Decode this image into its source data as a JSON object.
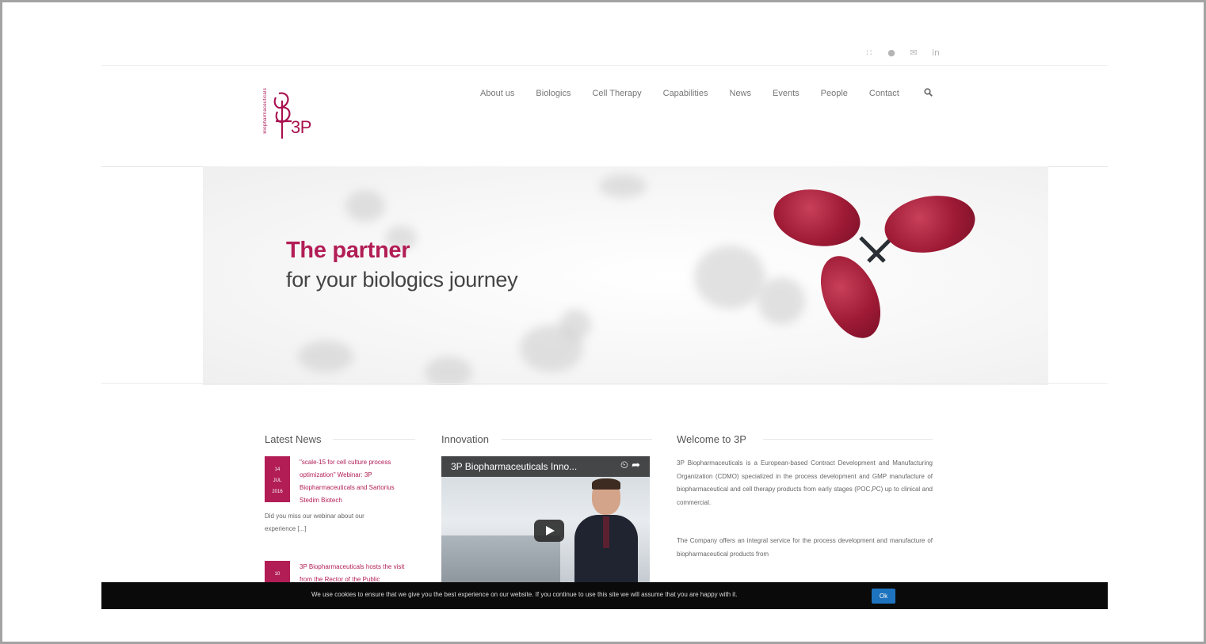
{
  "social": {
    "icons": [
      "rss-icon",
      "twitter-icon",
      "email-icon",
      "linkedin-icon"
    ],
    "glyphs": [
      ")",
      "•",
      "✉",
      "in"
    ]
  },
  "logo": {
    "text": "3P",
    "vertical": "Biopharmaceuticals",
    "color": "#a8124f"
  },
  "nav": {
    "items": [
      "About us",
      "Biologics",
      "Cell Therapy",
      "Capabilities",
      "News",
      "Events",
      "People",
      "Contact"
    ],
    "search_glyph": "⚲"
  },
  "hero": {
    "headline": "The partner",
    "subline": "for your biologics journey"
  },
  "latest_news": {
    "heading": "Latest News",
    "items": [
      {
        "date": "14\nJUL\n2016",
        "title": "\"scale-15 for cell culture process optimization\" Webinar: 3P Biopharmaceuticals and Sartorius Stedim Biotech",
        "excerpt": "Did you miss our webinar about our experience [...]"
      },
      {
        "date": "10",
        "title": "3P Biopharmaceuticals hosts the visit from the Rector of the Public",
        "excerpt": ""
      }
    ]
  },
  "innovation": {
    "heading": "Innovation",
    "video_title": "3P Biopharmaceuticals Inno...",
    "video_icons": "⏲ ➦"
  },
  "welcome": {
    "heading": "Welcome to 3P",
    "paragraph1": "3P Biopharmaceuticals is a European-based Contract Development and Manufacturing Organization (CDMO) specialized in the process development and GMP manufacture of biopharmaceutical and cell therapy products from early stages (POC,PC) up to clinical and commercial.",
    "paragraph2": "The Company offers an integral service for the process development and manufacture of biopharmaceutical products from"
  },
  "cookie": {
    "message": "We use cookies to ensure that we give you the best experience on our website. If you continue to use this site we will assume that you are happy with it.",
    "ok_label": "Ok"
  },
  "colors": {
    "brand": "#b21d55",
    "cookie_bg": "#0a0a0a",
    "ok_button": "#1e73be"
  }
}
